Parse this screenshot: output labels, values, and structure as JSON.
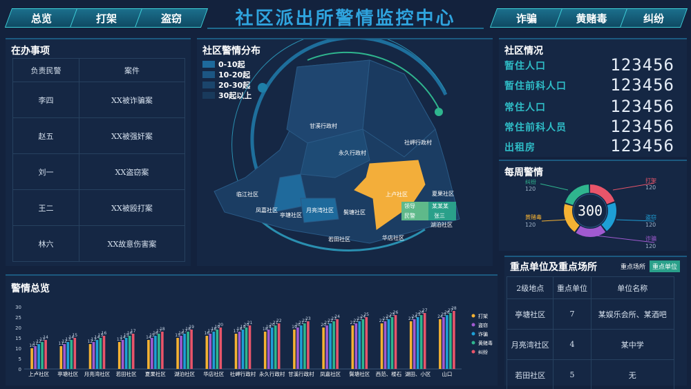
{
  "nav_left": [
    "总览",
    "打架",
    "盗窃"
  ],
  "nav_right": [
    "诈骗",
    "黄赌毒",
    "纠纷"
  ],
  "title": "社区派出所警情监控中心",
  "todo": {
    "title": "在办事项",
    "headers": [
      "负责民警",
      "案件"
    ],
    "rows": [
      [
        "李四",
        "XX被诈骗案"
      ],
      [
        "赵五",
        "XX被强奸案"
      ],
      [
        "刘一",
        "XX盗窃案"
      ],
      [
        "王二",
        "XX被殴打案"
      ],
      [
        "林六",
        "XX故意伤害案"
      ]
    ]
  },
  "map": {
    "title": "社区警情分布",
    "legend": [
      {
        "label": "0-10起",
        "color": "#1e6a9c"
      },
      {
        "label": "10-20起",
        "color": "#1c5683"
      },
      {
        "label": "20-30起",
        "color": "#1b456c"
      },
      {
        "label": "30起以上",
        "color": "#193a5c"
      }
    ],
    "labels": [
      "甘溪行政村",
      "社岬行政村",
      "永久行政村",
      "临江社区",
      "上卢社区",
      "夏果社区",
      "凤嘉社区",
      "亭塘社区",
      "月亮湾社区",
      "鬓塘社区",
      "领导",
      "某某某",
      "民警",
      "张三",
      "湖泊社区",
      "若田社区",
      "华店社区"
    ]
  },
  "community": {
    "title": "社区情况",
    "items": [
      {
        "label": "暂住人口",
        "value": "123456"
      },
      {
        "label": "暂住前科人口",
        "value": "123456"
      },
      {
        "label": "常住人口",
        "value": "123456"
      },
      {
        "label": "常住前科人员",
        "value": "123456"
      },
      {
        "label": "出租房",
        "value": "123456"
      }
    ]
  },
  "weekly": {
    "title": "每周警情",
    "total": "300",
    "segments": [
      {
        "name": "打架",
        "value": "120",
        "color": "#e8556a"
      },
      {
        "name": "盗窃",
        "value": "120",
        "color": "#1e9fd6"
      },
      {
        "name": "诈骗",
        "value": "120",
        "color": "#a05ad0"
      },
      {
        "name": "黄赌毒",
        "value": "120",
        "color": "#f5b233"
      },
      {
        "name": "纠纷",
        "value": "120",
        "color": "#2fb58e"
      }
    ]
  },
  "key_units": {
    "title": "重点单位及重点场所",
    "tabs": [
      "重点场所",
      "重点单位"
    ],
    "headers": [
      "2级地点",
      "重点单位",
      "单位名称"
    ],
    "rows": [
      [
        "亭塘社区",
        "7",
        "某娱乐会所、某酒吧"
      ],
      [
        "月亮湾社区",
        "4",
        "某中学"
      ],
      [
        "若田社区",
        "5",
        "无"
      ]
    ]
  },
  "overview": {
    "title": "警情总览"
  },
  "chart_data": {
    "type": "bar",
    "categories": [
      "上卢社区",
      "亭塘社区",
      "月亮湾社区",
      "若田社区",
      "夏果社区",
      "湖泊社区",
      "华店社区",
      "社岬行政村",
      "永久行政村",
      "甘溪行政村",
      "凤嘉社区",
      "鬓塘社区",
      "西范、楼石",
      "湖田、小区",
      "山口"
    ],
    "ylim": [
      0,
      30
    ],
    "yticks": [
      0,
      5,
      10,
      15,
      20,
      25,
      30
    ],
    "series": [
      {
        "name": "打架",
        "color": "#f5b233",
        "values": [
          10,
          11,
          12,
          13,
          14,
          15,
          16,
          17,
          18,
          19,
          20,
          21,
          22,
          23,
          24
        ]
      },
      {
        "name": "盗窃",
        "color": "#a05ad0",
        "values": [
          11,
          12,
          13,
          14,
          15,
          16,
          17,
          18,
          19,
          20,
          21,
          22,
          23,
          24,
          25
        ]
      },
      {
        "name": "诈骗",
        "color": "#1e9fd6",
        "values": [
          12,
          13,
          14,
          15,
          16,
          17,
          18,
          19,
          20,
          21,
          22,
          23,
          24,
          25,
          26
        ]
      },
      {
        "name": "黄赌毒",
        "color": "#2fb58e",
        "values": [
          13,
          14,
          15,
          16,
          17,
          18,
          19,
          20,
          21,
          22,
          23,
          24,
          25,
          26,
          27
        ]
      },
      {
        "name": "纠纷",
        "color": "#e8556a",
        "values": [
          14,
          15,
          16,
          17,
          18,
          19,
          20,
          21,
          22,
          23,
          24,
          25,
          26,
          27,
          28
        ]
      }
    ]
  }
}
